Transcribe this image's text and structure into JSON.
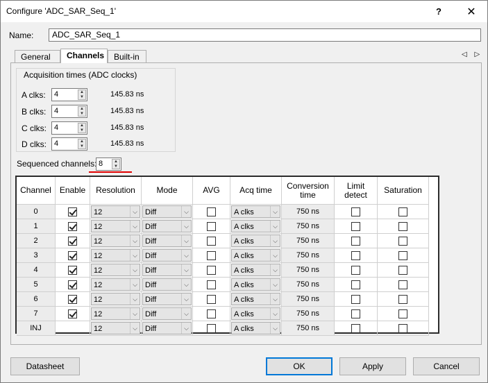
{
  "window": {
    "title": "Configure 'ADC_SAR_Seq_1'",
    "help": "?",
    "close": "✕"
  },
  "name": {
    "label": "Name:",
    "value": "ADC_SAR_Seq_1"
  },
  "tabs": [
    {
      "label": "General",
      "active": false
    },
    {
      "label": "Channels",
      "active": true
    },
    {
      "label": "Built-in",
      "active": false
    }
  ],
  "tab_arrows": "◁ ▷",
  "acquisition": {
    "title": "Acquisition times (ADC clocks)",
    "rows": [
      {
        "label": "A clks:",
        "value": "4",
        "time": "145.83 ns"
      },
      {
        "label": "B clks:",
        "value": "4",
        "time": "145.83 ns"
      },
      {
        "label": "C clks:",
        "value": "4",
        "time": "145.83 ns"
      },
      {
        "label": "D clks:",
        "value": "4",
        "time": "145.83 ns"
      }
    ]
  },
  "sequenced": {
    "label": "Sequenced channels:",
    "value": "8"
  },
  "table": {
    "headers": [
      "Channel",
      "Enable",
      "Resolution",
      "Mode",
      "AVG",
      "Acq time",
      "Conversion time",
      "Limit detect",
      "Saturation"
    ],
    "rows": [
      {
        "channel": "0",
        "enable": true,
        "resolution": "12",
        "mode": "Diff",
        "avg": false,
        "acq": "A clks",
        "conv": "750 ns",
        "limit": false,
        "sat": false
      },
      {
        "channel": "1",
        "enable": true,
        "resolution": "12",
        "mode": "Diff",
        "avg": false,
        "acq": "A clks",
        "conv": "750 ns",
        "limit": false,
        "sat": false
      },
      {
        "channel": "2",
        "enable": true,
        "resolution": "12",
        "mode": "Diff",
        "avg": false,
        "acq": "A clks",
        "conv": "750 ns",
        "limit": false,
        "sat": false
      },
      {
        "channel": "3",
        "enable": true,
        "resolution": "12",
        "mode": "Diff",
        "avg": false,
        "acq": "A clks",
        "conv": "750 ns",
        "limit": false,
        "sat": false
      },
      {
        "channel": "4",
        "enable": true,
        "resolution": "12",
        "mode": "Diff",
        "avg": false,
        "acq": "A clks",
        "conv": "750 ns",
        "limit": false,
        "sat": false
      },
      {
        "channel": "5",
        "enable": true,
        "resolution": "12",
        "mode": "Diff",
        "avg": false,
        "acq": "A clks",
        "conv": "750 ns",
        "limit": false,
        "sat": false
      },
      {
        "channel": "6",
        "enable": true,
        "resolution": "12",
        "mode": "Diff",
        "avg": false,
        "acq": "A clks",
        "conv": "750 ns",
        "limit": false,
        "sat": false
      },
      {
        "channel": "7",
        "enable": true,
        "resolution": "12",
        "mode": "Diff",
        "avg": false,
        "acq": "A clks",
        "conv": "750 ns",
        "limit": false,
        "sat": false
      },
      {
        "channel": "INJ",
        "enable": null,
        "resolution": "12",
        "mode": "Diff",
        "avg": false,
        "acq": "A clks",
        "conv": "750 ns",
        "limit": false,
        "sat": false
      }
    ]
  },
  "buttons": {
    "datasheet": "Datasheet",
    "ok": "OK",
    "apply": "Apply",
    "cancel": "Cancel"
  },
  "colors": {
    "accent": "#0078d7",
    "highlight": "#e00000"
  }
}
